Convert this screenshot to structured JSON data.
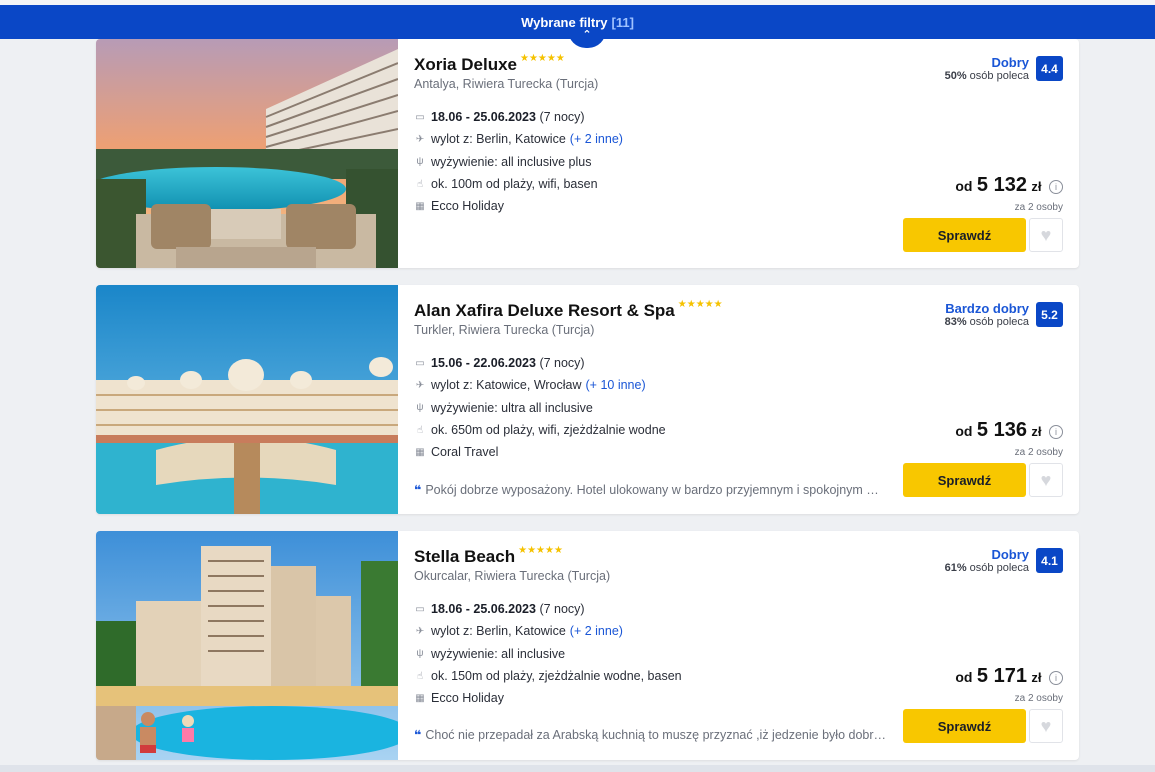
{
  "filter_bar": {
    "label": "Wybrane filtry",
    "count": "[11]",
    "toggle_icon": "chevron-up-icon"
  },
  "hotels": [
    {
      "name": "Xoria Deluxe",
      "stars": "★★★★★",
      "location": "Antalya, Riwiera Turecka (Turcja)",
      "dates": "18.06 - 25.06.2023",
      "nights": "(7 nocy)",
      "departure": "wylot z: Berlin, Katowice",
      "departure_more": "(+ 2 inne)",
      "board": "wyżywienie: all inclusive plus",
      "features": "ok. 100m od plaży, wifi, basen",
      "operator": "Ecco Holiday",
      "review": "",
      "rating_label": "Dobry",
      "rating_pct": "50%",
      "rating_sub": "osób poleca",
      "score": "4.4",
      "price_prefix": "od",
      "price": "5 132",
      "currency": "zł",
      "price_note": "za 2 osoby",
      "button": "Sprawdź"
    },
    {
      "name": "Alan Xafira Deluxe Resort & Spa",
      "stars": "★★★★★",
      "location": "Turkler, Riwiera Turecka (Turcja)",
      "dates": "15.06 - 22.06.2023",
      "nights": "(7 nocy)",
      "departure": "wylot z: Katowice, Wrocław",
      "departure_more": "(+ 10 inne)",
      "board": "wyżywienie: ultra all inclusive",
      "features": "ok. 650m od plaży, wifi, zjeżdżalnie wodne",
      "operator": "Coral Travel",
      "review": "Pokój dobrze wyposażony. Hotel ulokowany w bardzo przyjemnym i spokojnym mi...",
      "rating_label": "Bardzo dobry",
      "rating_pct": "83%",
      "rating_sub": "osób poleca",
      "score": "5.2",
      "price_prefix": "od",
      "price": "5 136",
      "currency": "zł",
      "price_note": "za 2 osoby",
      "button": "Sprawdź"
    },
    {
      "name": "Stella Beach",
      "stars": "★★★★★",
      "location": "Okurcalar, Riwiera Turecka (Turcja)",
      "dates": "18.06 - 25.06.2023",
      "nights": "(7 nocy)",
      "departure": "wylot z: Berlin, Katowice",
      "departure_more": "(+ 2 inne)",
      "board": "wyżywienie: all inclusive",
      "features": "ok. 150m od plaży, zjeżdżalnie wodne, basen",
      "operator": "Ecco Holiday",
      "review": "Choć nie przepadał za Arabską kuchnią to muszę przyznać ,iż jedzenie było dobre. ...",
      "rating_label": "Dobry",
      "rating_pct": "61%",
      "rating_sub": "osób poleca",
      "score": "4.1",
      "price_prefix": "od",
      "price": "5 171",
      "currency": "zł",
      "price_note": "za 2 osoby",
      "button": "Sprawdź"
    }
  ]
}
